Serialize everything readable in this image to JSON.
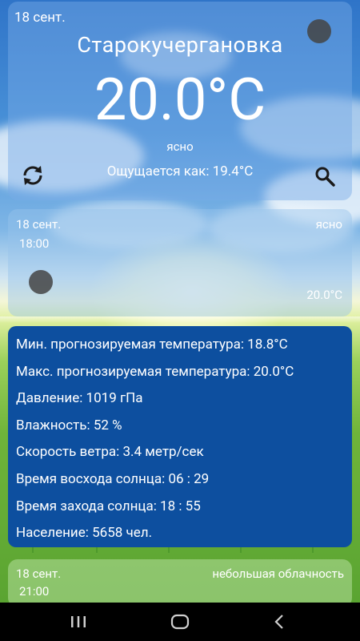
{
  "current": {
    "date": "18 сент.",
    "city": "Старокучергановка",
    "temperature": "20.0°C",
    "condition": "ясно",
    "feels_like": "Ощущается как: 19.4°C"
  },
  "icons": {
    "refresh": "refresh-icon",
    "search": "search-icon"
  },
  "forecast": {
    "date": "18 сент.",
    "time": "18:00",
    "condition": "ясно",
    "temperature": "20.0°C"
  },
  "details": [
    "Мин. прогнозируемая температура: 18.8°C",
    "Макс. прогнозируемая температура: 20.0°C",
    "Давление: 1019 гПа",
    "Влажность: 52 %",
    "Скорость ветра: 3.4 метр/сек",
    "Время восхода солнца:  06 : 29",
    "Время захода солнца:  18 : 55",
    "Население: 5658 чел."
  ],
  "next_forecast": {
    "date": "18 сент.",
    "condition": "небольшая облачность",
    "time": "21:00"
  },
  "colors": {
    "details_bg": "#0d4f9f",
    "text": "#ffffff",
    "navbar": "#000000"
  },
  "navbar": {
    "recent": "recent-apps-icon",
    "home": "home-icon",
    "back": "back-icon"
  }
}
